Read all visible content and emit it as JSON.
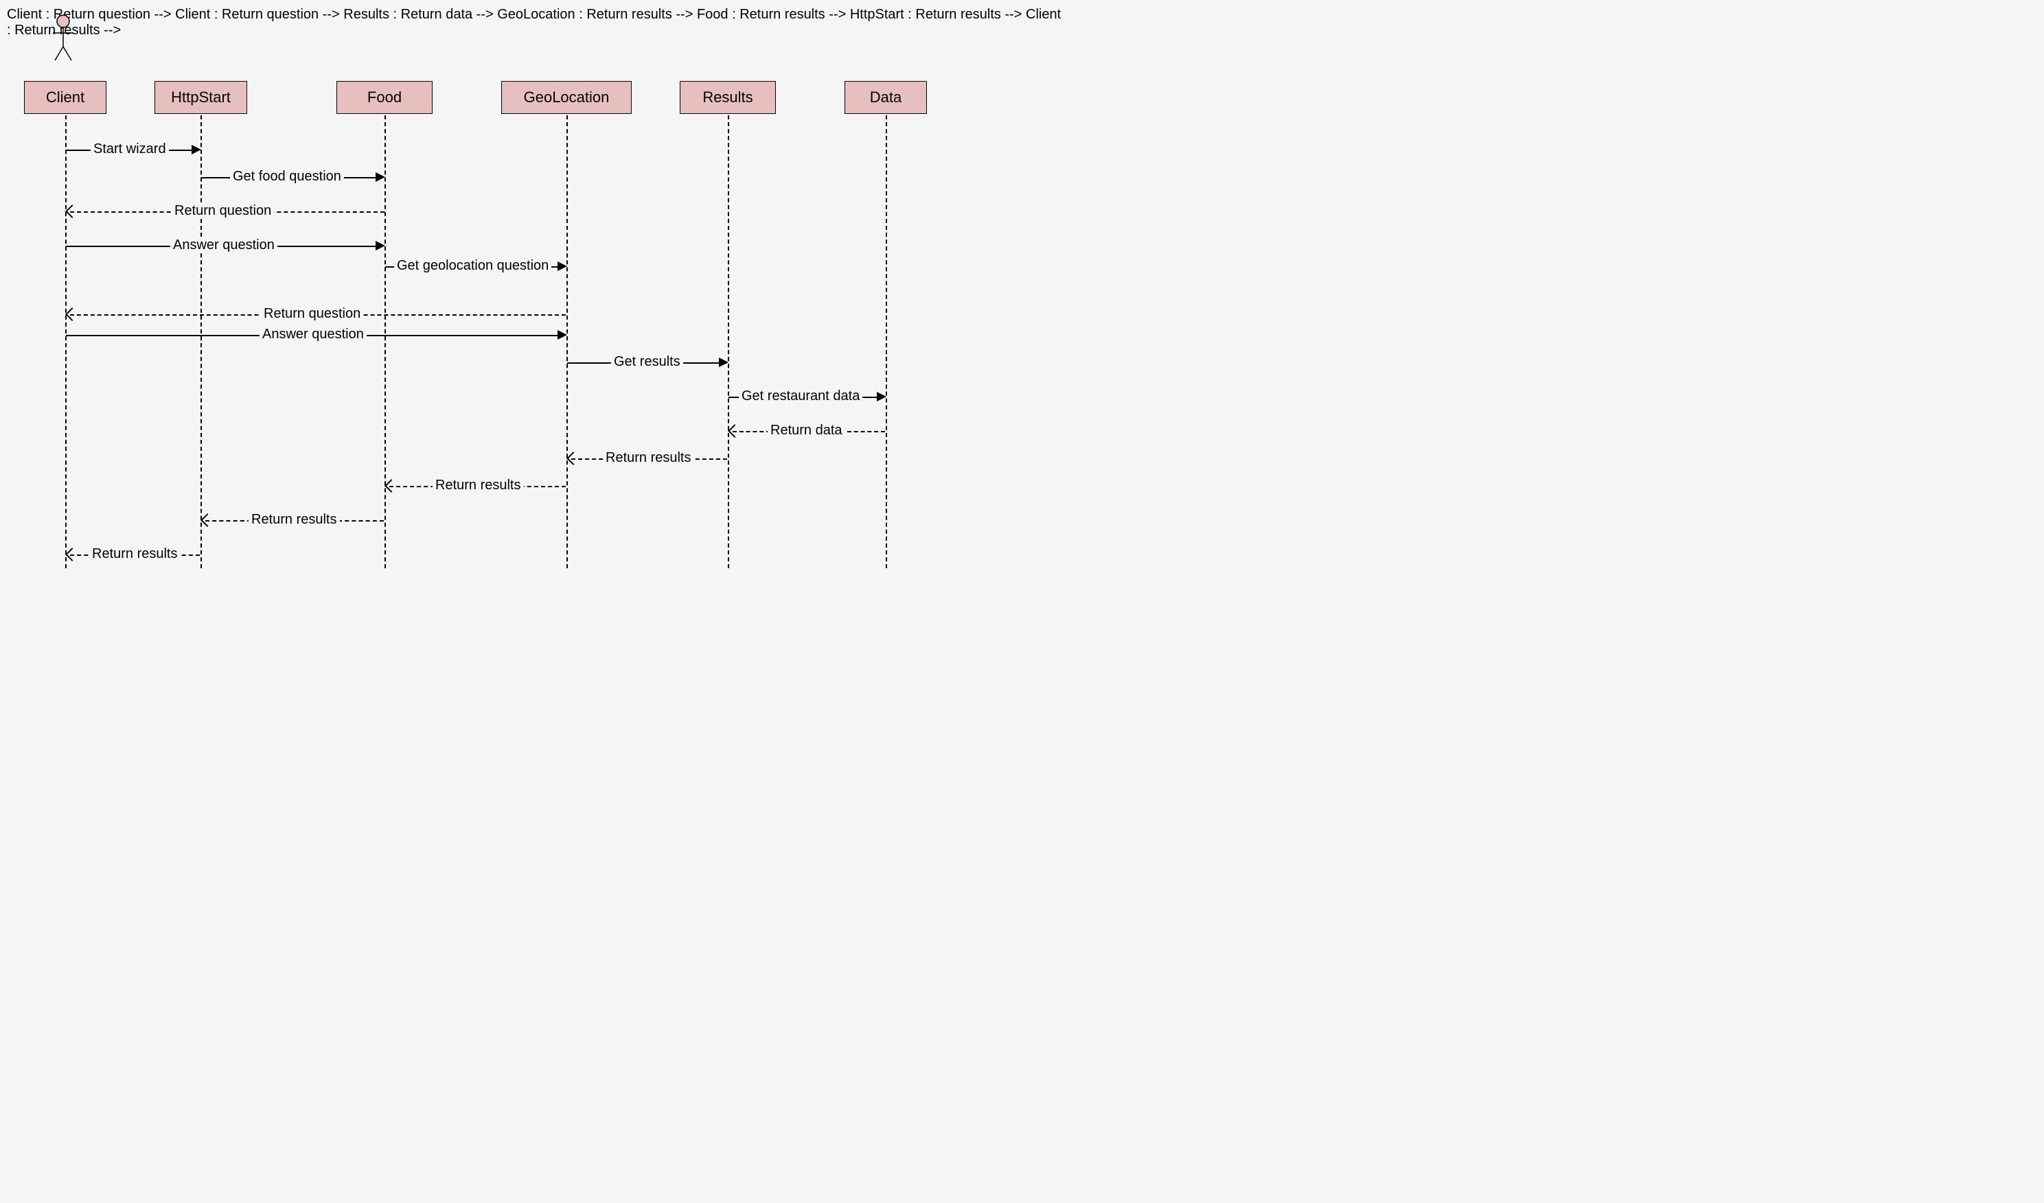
{
  "participants": {
    "client": "Client",
    "httpstart": "HttpStart",
    "food": "Food",
    "geolocation": "GeoLocation",
    "results": "Results",
    "data": "Data"
  },
  "messages": {
    "m1": "Start wizard",
    "m2": "Get food question",
    "m3": "Return question",
    "m4": "Answer question",
    "m5": "Get geolocation question",
    "m6": "Return question",
    "m7": "Answer question",
    "m8": "Get results",
    "m9": "Get restaurant data",
    "m10": "Return data",
    "m11": "Return results",
    "m12": "Return results",
    "m13": "Return results",
    "m14": "Return results"
  }
}
